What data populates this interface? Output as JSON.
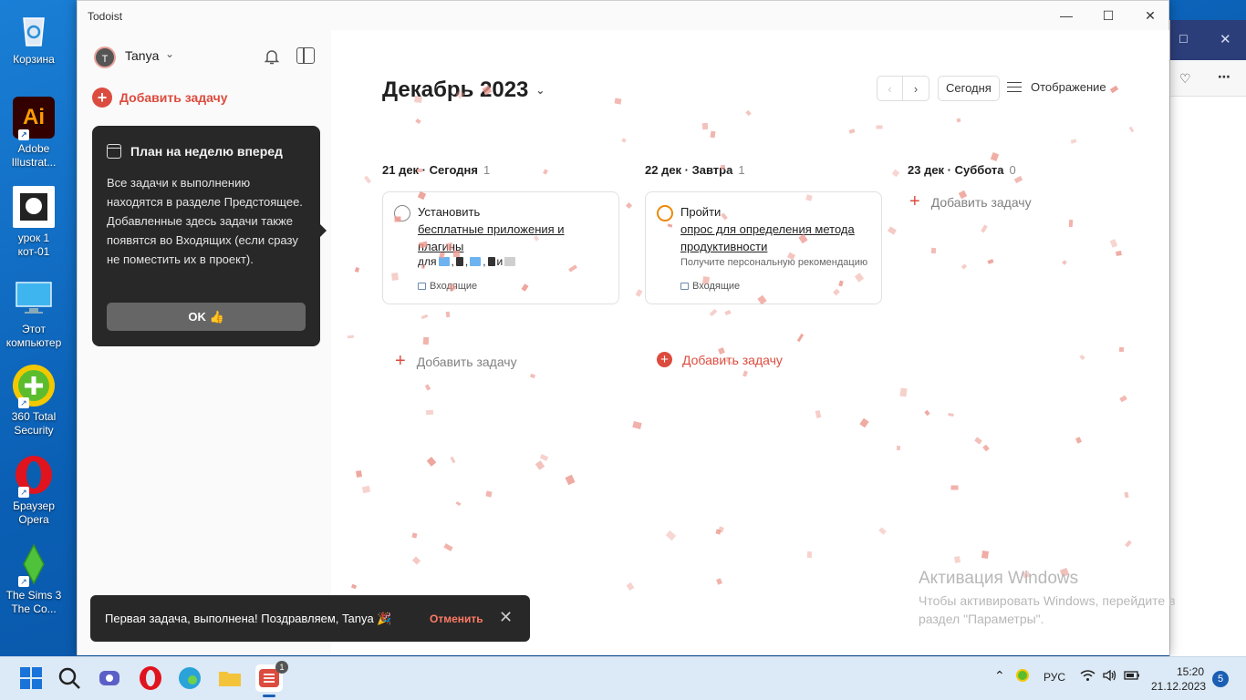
{
  "desktop": {
    "icons": [
      {
        "label": "Корзина",
        "icon": "recycle-bin-icon"
      },
      {
        "label": "Adobe Illustrat...",
        "icon": "illustrator-icon",
        "glyph": "Ai"
      },
      {
        "label": "урок 1 кот-01",
        "icon": "image-file-icon"
      },
      {
        "label": "Этот компьютер",
        "icon": "monitor-icon"
      },
      {
        "label": "360 Total Security",
        "icon": "security-icon"
      },
      {
        "label": "Браузер Opera",
        "icon": "opera-icon"
      },
      {
        "label": "The Sims 3 The Co...",
        "icon": "sims-icon"
      }
    ]
  },
  "app": {
    "title": "Todoist",
    "window_controls": {
      "minimize": "—",
      "maximize": "☐",
      "close": "✕"
    },
    "sidebar": {
      "avatar_letter": "T",
      "username": "Tanya",
      "add_task": "Добавить задачу"
    },
    "tooltip": {
      "title": "План на неделю вперед",
      "body": "Все задачи к выполнению находятся в разделе Предстоящее. Добавленные здесь задачи также появятся во Входящих (если сразу не поместить их в проект).",
      "ok_label": "OK 👍"
    },
    "header": {
      "month": "Декабрь 2023",
      "prev": "‹",
      "next": "›",
      "today": "Сегодня",
      "view": "Отображение"
    },
    "columns": [
      {
        "title": "21 дек · Сегодня",
        "count": "1",
        "task": {
          "title": "Установить",
          "link": "бесплатные приложения и плагины",
          "extra_prefix": "для",
          "extra_and": "и",
          "project": "Входящие"
        },
        "add_label": "Добавить задачу"
      },
      {
        "title": "22 дек · Завтра",
        "count": "1",
        "task": {
          "title": "Пройти",
          "link": "опрос для определения метода продуктивности",
          "subtitle": "Получите персональную рекомендацию",
          "project": "Входящие"
        },
        "add_label": "Добавить задачу"
      },
      {
        "title": "23 дек · Суббота",
        "count": "0",
        "add_label": "Добавить задачу"
      }
    ],
    "toast": {
      "message": "Первая задача, выполнена! Поздравляем, Tanya",
      "emoji": "🎉",
      "undo": "Отменить",
      "close": "✕"
    }
  },
  "watermark": {
    "title": "Активация Windows",
    "text": "Чтобы активировать Windows, перейдите в раздел \"Параметры\"."
  },
  "taskbar": {
    "tray_lang": "РУС",
    "time": "15:20",
    "date": "21.12.2023",
    "notifications": "5",
    "todoist_badge": "1"
  },
  "colors": {
    "accent": "#dc4c3e",
    "priority_orange": "#eb8909",
    "tooltip_bg": "#282828"
  }
}
